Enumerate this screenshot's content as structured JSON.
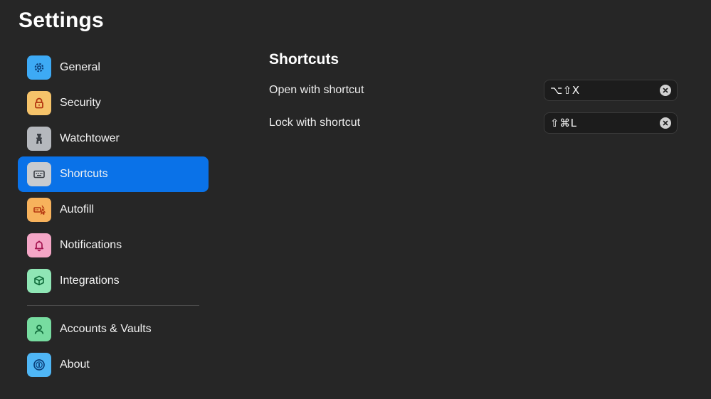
{
  "page": {
    "title": "Settings"
  },
  "sidebar": {
    "items": [
      {
        "label": "General",
        "icon": "gear-icon",
        "color": "#3daaf5",
        "active": false
      },
      {
        "label": "Security",
        "icon": "lock-icon",
        "color": "#f6c36a",
        "active": false
      },
      {
        "label": "Watchtower",
        "icon": "watchtower-icon",
        "color": "#b5b8bd",
        "active": false
      },
      {
        "label": "Shortcuts",
        "icon": "keyboard-icon",
        "color": "#c8cbcf",
        "active": true
      },
      {
        "label": "Autofill",
        "icon": "autofill-icon",
        "color": "#f7b25c",
        "active": false
      },
      {
        "label": "Notifications",
        "icon": "bell-icon",
        "color": "#f4a6c6",
        "active": false
      },
      {
        "label": "Integrations",
        "icon": "integrations-icon",
        "color": "#8fe6b5",
        "active": false
      }
    ],
    "bottom_items": [
      {
        "label": "Accounts & Vaults",
        "icon": "person-icon",
        "color": "#77dca0"
      },
      {
        "label": "About",
        "icon": "onepassword-icon",
        "color": "#4fb6f5"
      }
    ],
    "active_color": "#0a72e8"
  },
  "content": {
    "title": "Shortcuts",
    "rows": [
      {
        "label": "Open with shortcut",
        "value": "⌥⇧X"
      },
      {
        "label": "Lock with shortcut",
        "value": "⇧⌘L"
      }
    ]
  }
}
